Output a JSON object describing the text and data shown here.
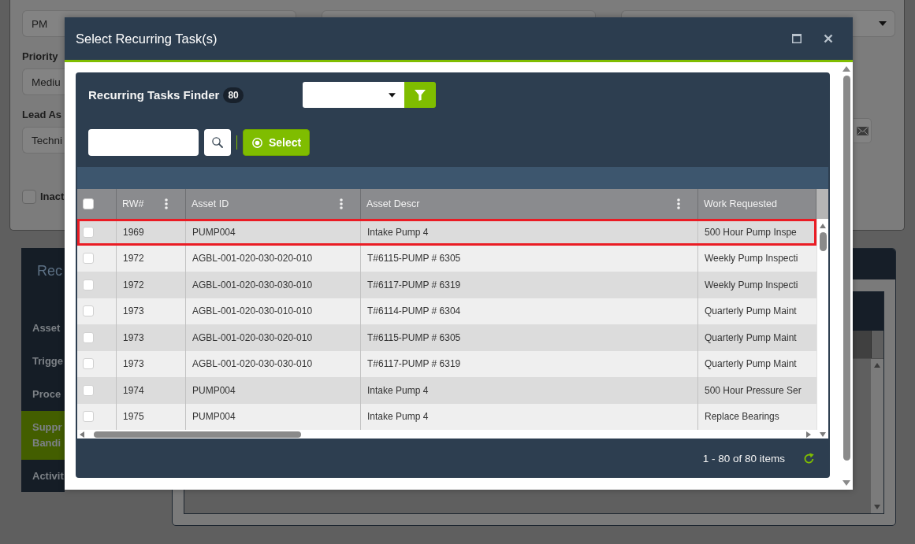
{
  "form": {
    "first_field": {
      "value": "PM"
    },
    "priority": {
      "label": "Priority",
      "value": "Mediu"
    },
    "lead": {
      "label": "Lead As",
      "value": "Techni"
    },
    "inactive": {
      "label": "Inact",
      "checked": false
    }
  },
  "side_menu": {
    "title": "Rec",
    "items": [
      {
        "label": "Asset",
        "selected": false
      },
      {
        "label": "Trigge",
        "selected": false
      },
      {
        "label": "Proce",
        "selected": false
      },
      {
        "label": "Suppr Bandi",
        "selected": true
      },
      {
        "label": "Activit",
        "selected": false
      }
    ]
  },
  "modal": {
    "title": "Select Recurring Task(s)",
    "finder": {
      "title": "Recurring Tasks Finder",
      "count": "80"
    },
    "select_button": "Select",
    "grid": {
      "header_checkbox": {
        "checked": false
      },
      "columns": [
        {
          "label": "RW#",
          "menu": true
        },
        {
          "label": "Asset ID",
          "menu": true
        },
        {
          "label": "Asset Descr",
          "menu": true
        },
        {
          "label": "Work Requested",
          "menu": false
        }
      ],
      "rows": [
        {
          "checked": false,
          "highlighted": true,
          "cells": [
            "1969",
            "PUMP004",
            "Intake Pump 4",
            "500 Hour Pump Inspe"
          ]
        },
        {
          "checked": false,
          "highlighted": false,
          "cells": [
            "1972",
            "AGBL-001-020-030-020-010",
            "T#6115-PUMP # 6305",
            "Weekly Pump Inspecti"
          ]
        },
        {
          "checked": false,
          "highlighted": false,
          "cells": [
            "1972",
            "AGBL-001-020-030-030-010",
            "T#6117-PUMP # 6319",
            "Weekly Pump Inspecti"
          ]
        },
        {
          "checked": false,
          "highlighted": false,
          "cells": [
            "1973",
            "AGBL-001-020-030-010-010",
            "T#6114-PUMP # 6304",
            "Quarterly Pump Maint"
          ]
        },
        {
          "checked": false,
          "highlighted": false,
          "cells": [
            "1973",
            "AGBL-001-020-030-020-010",
            "T#6115-PUMP # 6305",
            "Quarterly Pump Maint"
          ]
        },
        {
          "checked": false,
          "highlighted": false,
          "cells": [
            "1973",
            "AGBL-001-020-030-030-010",
            "T#6117-PUMP # 6319",
            "Quarterly Pump Maint"
          ]
        },
        {
          "checked": false,
          "highlighted": false,
          "cells": [
            "1974",
            "PUMP004",
            "Intake Pump 4",
            "500 Hour Pressure Ser"
          ]
        },
        {
          "checked": false,
          "highlighted": false,
          "cells": [
            "1975",
            "PUMP004",
            "Intake Pump 4",
            "Replace Bearings"
          ]
        }
      ]
    },
    "pager": "1 - 80 of 80 items"
  }
}
